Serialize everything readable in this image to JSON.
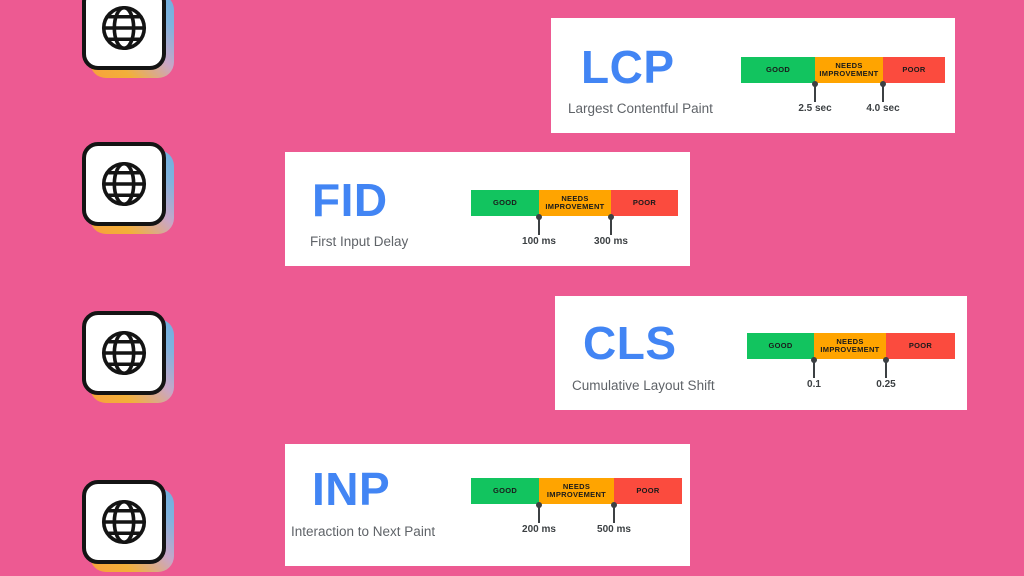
{
  "background_color": "#ED5A92",
  "theme": {
    "accent_blue": "#4285F4",
    "good_color": "#12C45F",
    "needs_improvement_color": "#FFA400",
    "poor_color": "#FB4B3E",
    "card_background": "#FFFFFF",
    "subtitle_color": "#5F6368"
  },
  "icons": {
    "globe": "globe-icon"
  },
  "legend": {
    "good": "GOOD",
    "needs_improvement_line1": "NEEDS",
    "needs_improvement_line2": "IMPROVEMENT",
    "poor": "POOR"
  },
  "cards": [
    {
      "abbr": "LCP",
      "full_name": "Largest Contentful Paint",
      "good_threshold": "2.5 sec",
      "poor_threshold": "4.0 sec"
    },
    {
      "abbr": "FID",
      "full_name": "First Input Delay",
      "good_threshold": "100 ms",
      "poor_threshold": "300 ms"
    },
    {
      "abbr": "CLS",
      "full_name": "Cumulative Layout Shift",
      "good_threshold": "0.1",
      "poor_threshold": "0.25"
    },
    {
      "abbr": "INP",
      "full_name": "Interaction to Next Paint",
      "good_threshold": "200 ms",
      "poor_threshold": "500 ms"
    }
  ]
}
